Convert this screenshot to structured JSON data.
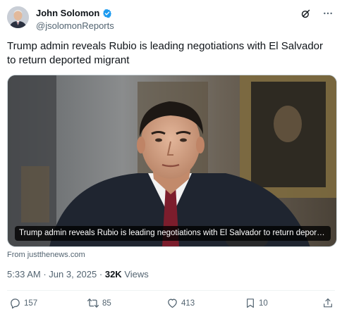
{
  "author": {
    "display_name": "John Solomon",
    "handle": "@jsolomonReports",
    "verified": true
  },
  "tweet": {
    "text": "Trump admin reveals Rubio is leading negotiations with El Salvador to return deported migrant"
  },
  "media": {
    "caption": "Trump admin reveals Rubio is leading negotiations with El Salvador to return deported ...",
    "source": "From justthenews.com"
  },
  "meta": {
    "time": "5:33 AM",
    "separator": "·",
    "date": "Jun 3, 2025",
    "views_count": "32K",
    "views_label": "Views"
  },
  "actions": {
    "replies": "157",
    "reposts": "85",
    "likes": "413",
    "bookmarks": "10"
  },
  "colors": {
    "accent": "#1d9bf0",
    "text_primary": "#0f1419",
    "text_secondary": "#536471",
    "divider": "#eff3f4"
  },
  "icons": [
    "verified-badge-icon",
    "grok-icon",
    "more-icon",
    "reply-icon",
    "repost-icon",
    "like-icon",
    "bookmark-icon",
    "share-icon"
  ]
}
